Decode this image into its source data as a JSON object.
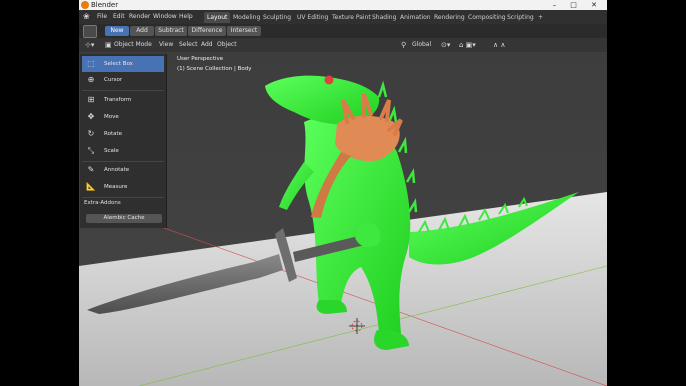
{
  "window": {
    "title": "Blender",
    "controls": "– □ ✕"
  },
  "menu": {
    "items": [
      "File",
      "Edit",
      "Render",
      "Window",
      "Help"
    ],
    "workspaces": [
      "Layout",
      "Modeling",
      "Sculpting",
      "UV Editing",
      "Texture Paint",
      "Shading",
      "Animation",
      "Rendering",
      "Compositing",
      "Scripting"
    ],
    "add_tab": "+"
  },
  "tool_header": {
    "buttons": [
      "New",
      "Add",
      "Subtract",
      "Difference",
      "Intersect"
    ]
  },
  "viewport_header": {
    "mode": "Object Mode",
    "menus": [
      "View",
      "Select",
      "Add",
      "Object"
    ],
    "orientation": "Global"
  },
  "viewport": {
    "perspective_label": "User Perspective",
    "collection_label": "(1) Scene Collection | Body"
  },
  "toolbar": {
    "tools": [
      {
        "label": "Select Box",
        "icon": "select-box-icon",
        "glyph": "⬚"
      },
      {
        "label": "Cursor",
        "icon": "cursor-icon",
        "glyph": "⊕"
      },
      {
        "label": "Transform",
        "icon": "transform-icon",
        "glyph": "⊞"
      },
      {
        "label": "Move",
        "icon": "move-icon",
        "glyph": "✥"
      },
      {
        "label": "Rotate",
        "icon": "rotate-icon",
        "glyph": "↻"
      },
      {
        "label": "Scale",
        "icon": "scale-icon",
        "glyph": "⤡"
      },
      {
        "label": "Annotate",
        "icon": "annotate-icon",
        "glyph": "✎"
      },
      {
        "label": "Measure",
        "icon": "measure-icon",
        "glyph": "📐"
      }
    ],
    "addons_title": "Extra-Addons",
    "addons_button": "Alembic Cache"
  }
}
